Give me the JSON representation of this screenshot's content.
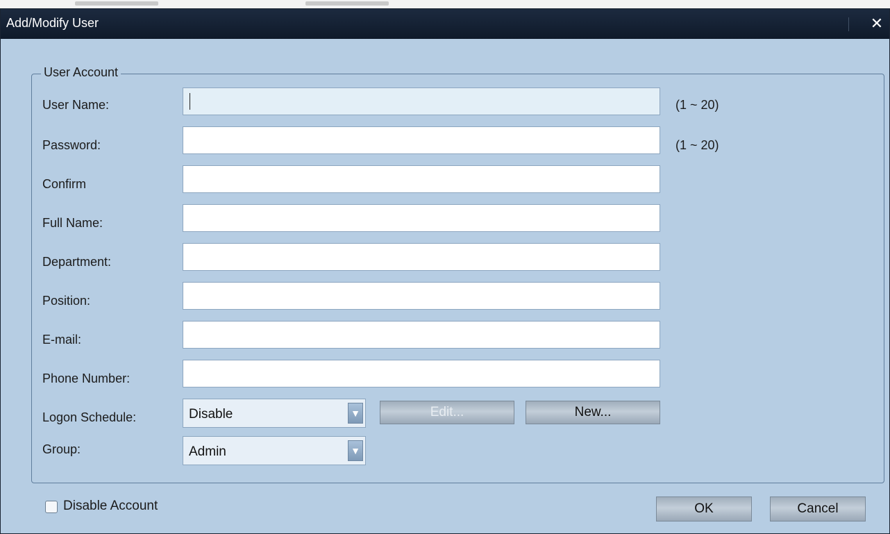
{
  "window": {
    "title": "Add/Modify User",
    "close_glyph": "✕",
    "close_icon": "close-icon"
  },
  "user_account": {
    "legend": "User Account",
    "fields": {
      "user_name": {
        "label": "User Name:",
        "value": "",
        "hint": "(1 ~ 20)"
      },
      "password": {
        "label": "Password:",
        "value": "",
        "hint": "(1 ~ 20)"
      },
      "confirm": {
        "label": "Confirm",
        "value": ""
      },
      "full_name": {
        "label": "Full Name:",
        "value": ""
      },
      "department": {
        "label": "Department:",
        "value": ""
      },
      "position": {
        "label": "Position:",
        "value": ""
      },
      "email": {
        "label": "E-mail:",
        "value": ""
      },
      "phone": {
        "label": "Phone Number:",
        "value": ""
      }
    },
    "logon_schedule": {
      "label": "Logon Schedule:",
      "selected": "Disable",
      "edit_label": "Edit...",
      "new_label": "New..."
    },
    "group": {
      "label": "Group:",
      "selected": "Admin"
    }
  },
  "footer": {
    "disable_account_label": "Disable Account",
    "disable_account_checked": false,
    "ok_label": "OK",
    "cancel_label": "Cancel"
  },
  "colors": {
    "dialog_bg": "#b6cde3",
    "titlebar_bg": "#0f1a2a",
    "title_text": "#ffffff"
  }
}
